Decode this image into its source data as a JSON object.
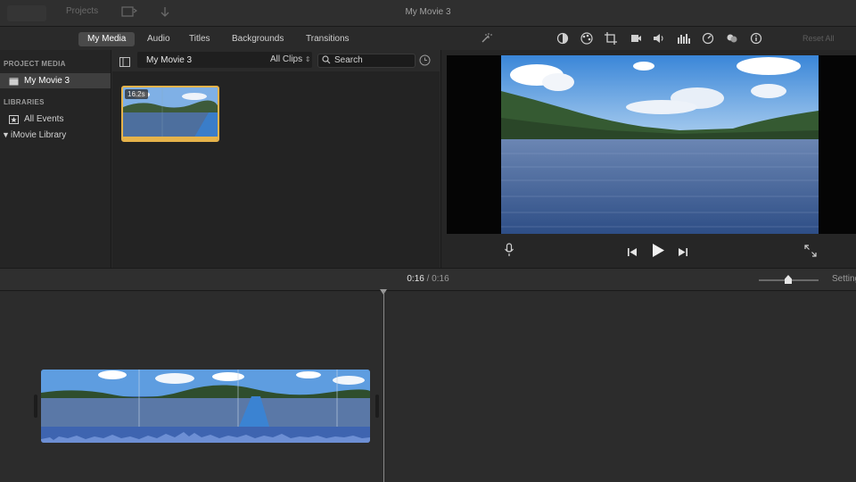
{
  "window": {
    "title": "My Movie 3"
  },
  "titlebar": {
    "faded_label": "Projects",
    "reset_all": "Reset All"
  },
  "tabs": [
    {
      "label": "My Media",
      "active": true
    },
    {
      "label": "Audio",
      "active": false
    },
    {
      "label": "Titles",
      "active": false
    },
    {
      "label": "Backgrounds",
      "active": false
    },
    {
      "label": "Transitions",
      "active": false
    }
  ],
  "sidebar": {
    "project_media_header": "PROJECT MEDIA",
    "project_item": "My Movie 3",
    "libraries_header": "LIBRARIES",
    "all_events": "All Events",
    "library": "iMovie Library"
  },
  "browser": {
    "project_name": "My Movie 3",
    "filter_label": "All Clips",
    "search_placeholder": "Search",
    "thumbnail_duration": "16.2s"
  },
  "timeline": {
    "current_time": "0:16",
    "separator": "/",
    "total_time": "0:16",
    "settings_label": "Settings"
  },
  "colors": {
    "accent_selected_tab": "#4a4a4a",
    "clip_border": "#e6b34a",
    "audio_wave": "#3e64b0"
  }
}
